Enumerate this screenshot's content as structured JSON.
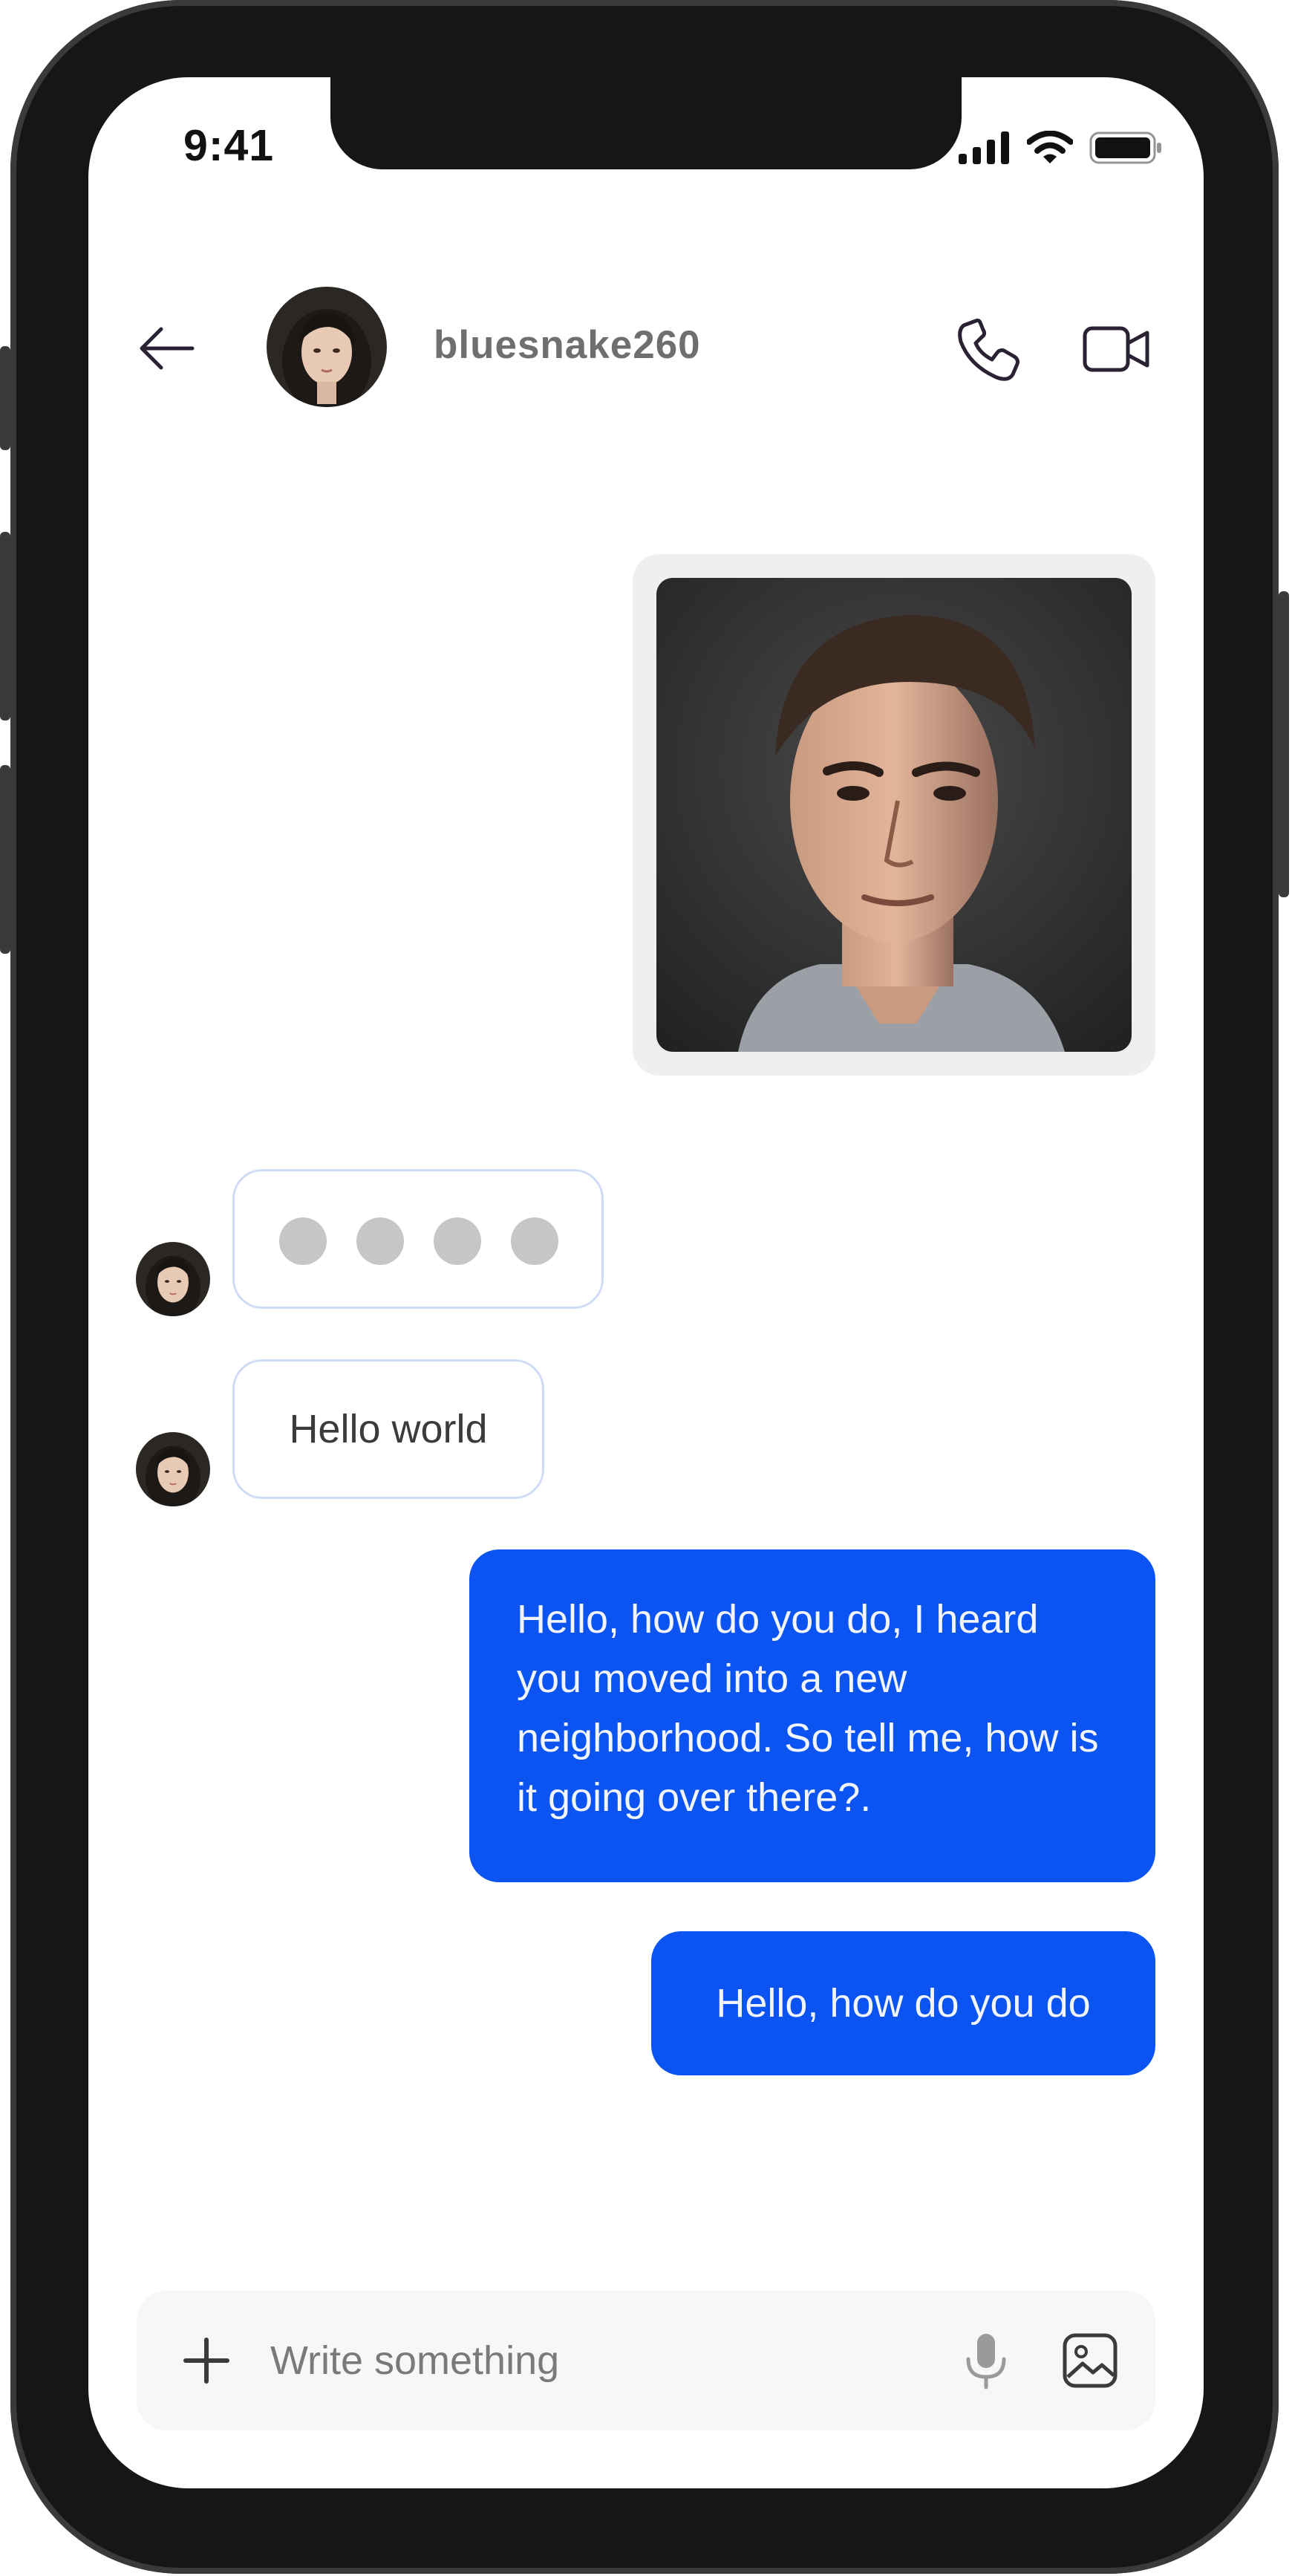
{
  "status_bar": {
    "time": "9:41",
    "icons": [
      "cellular-signal-icon",
      "wifi-icon",
      "battery-icon"
    ]
  },
  "header": {
    "back_icon": "arrow-left-icon",
    "contact_name": "bluesnake260",
    "call_icon": "phone-icon",
    "video_icon": "video-camera-icon"
  },
  "messages": [
    {
      "direction": "outgoing",
      "type": "image"
    },
    {
      "direction": "incoming",
      "type": "typing-indicator",
      "dots": 4
    },
    {
      "direction": "incoming",
      "type": "text",
      "text": "Hello world"
    },
    {
      "direction": "outgoing",
      "type": "text",
      "text": "Hello, how do you do, I heard you moved into a new neighborhood. So tell me, how is it going over there?."
    },
    {
      "direction": "outgoing",
      "type": "text",
      "text": "Hello, how do you do"
    }
  ],
  "composer": {
    "add_icon": "plus-icon",
    "placeholder": "Write something",
    "mic_icon": "microphone-icon",
    "image_icon": "image-icon"
  },
  "colors": {
    "accent": "#0b54f2",
    "frame": "#161616",
    "incoming_border": "#cfdcf6",
    "composer_bg": "#f7f7f7",
    "typing_dot": "#c6c6c6"
  }
}
